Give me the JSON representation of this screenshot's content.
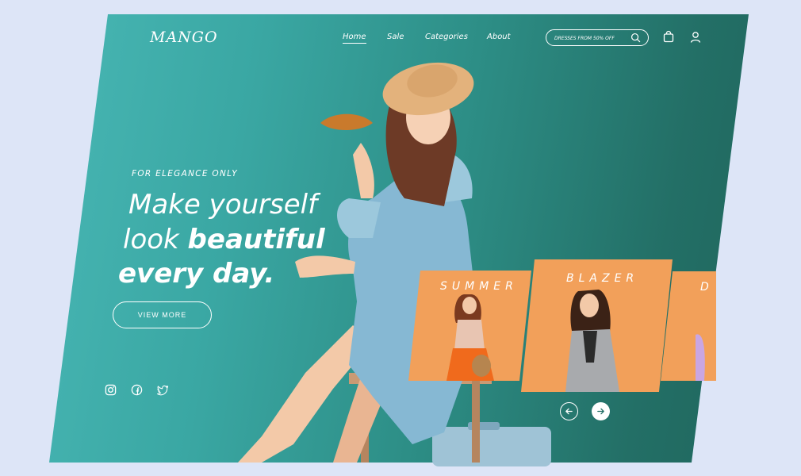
{
  "brand": {
    "logo": "MANGO"
  },
  "nav": {
    "items": [
      {
        "label": "Home",
        "active": true
      },
      {
        "label": "Sale"
      },
      {
        "label": "Categories"
      },
      {
        "label": "About"
      }
    ]
  },
  "search": {
    "placeholder": "DRESSES FROM 50% OFF",
    "icon": "search-icon"
  },
  "header_icons": {
    "cart": "shopping-bag-icon",
    "account": "user-icon"
  },
  "hero": {
    "tagline": "FOR ELEGANCE ONLY",
    "line1": "Make yourself",
    "line2_light": "look ",
    "line2_bold": "beautiful",
    "line3": "every day.",
    "cta": "VIEW MORE"
  },
  "social": [
    "instagram-icon",
    "facebook-icon",
    "twitter-icon"
  ],
  "carousel": {
    "cards": [
      {
        "title": "SUMMER"
      },
      {
        "title": "BLAZER"
      },
      {
        "title": "D"
      }
    ],
    "prev_icon": "arrow-left-icon",
    "next_icon": "arrow-right-icon"
  },
  "colors": {
    "accent": "#f2a05a",
    "panel_start": "#4bbab8",
    "panel_end": "#1e6359",
    "background": "#dde5f7"
  }
}
